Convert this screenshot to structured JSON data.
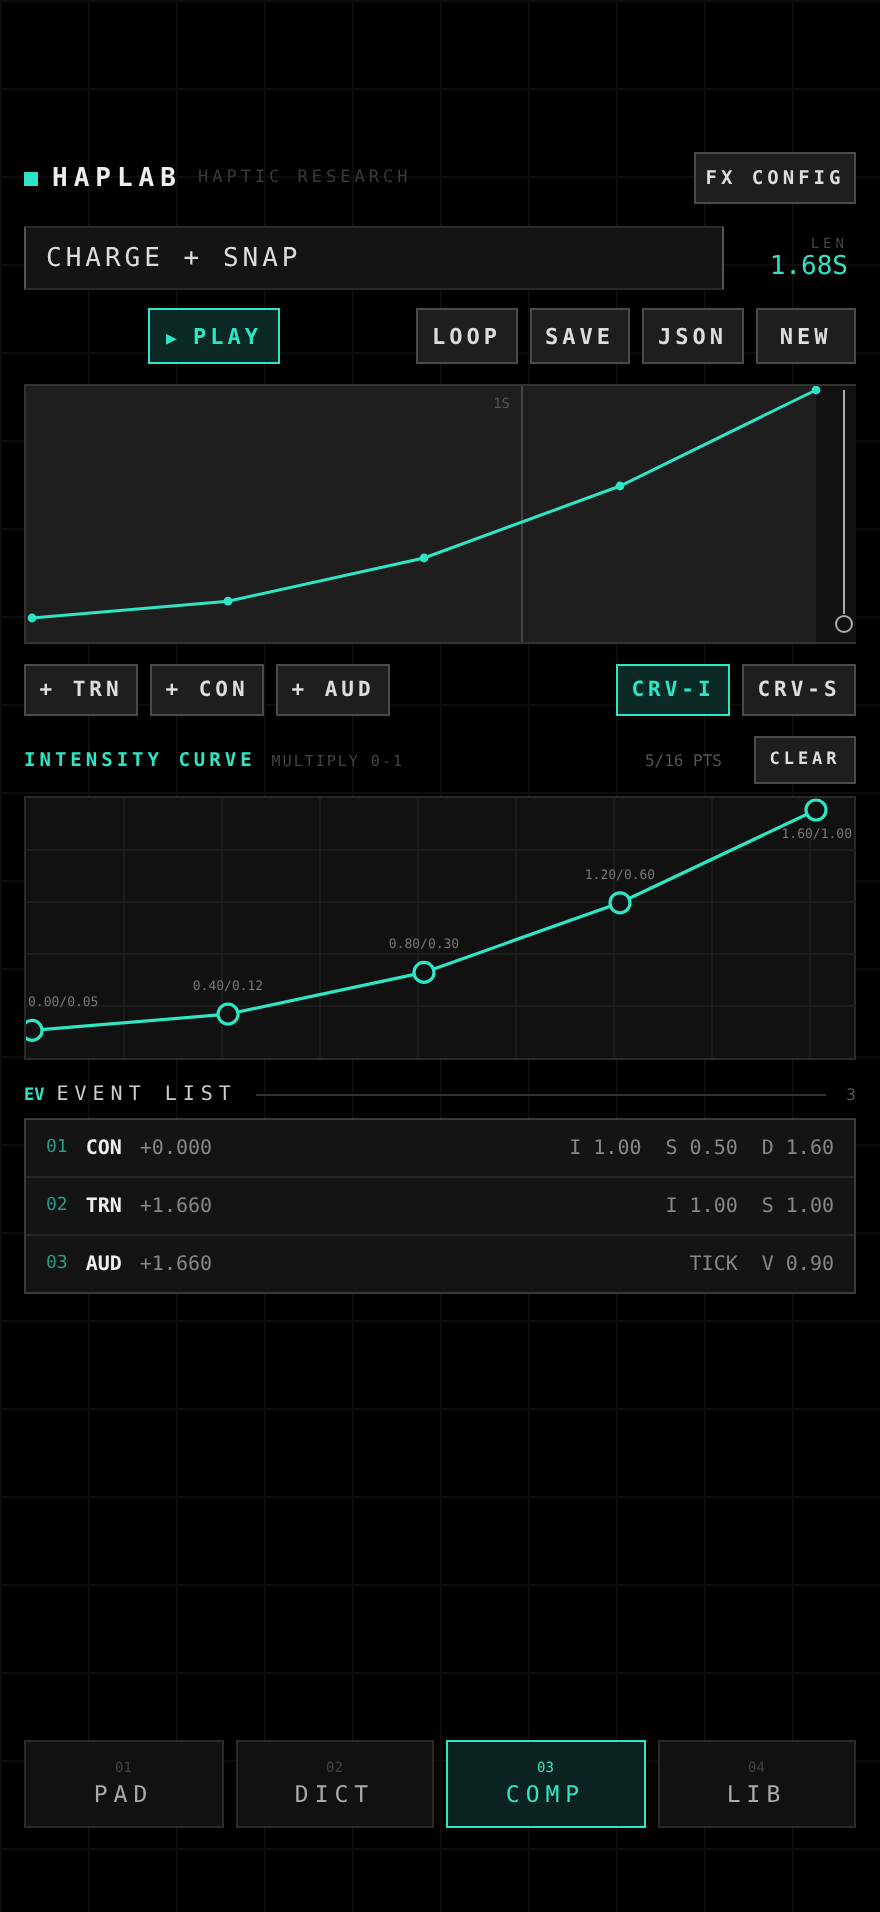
{
  "header": {
    "logo": "HAPLAB",
    "subtitle": "HAPTIC RESEARCH",
    "config_button": "FX CONFIG"
  },
  "pattern": {
    "name": "CHARGE + SNAP",
    "length_label": "LEN",
    "length": "1.68S"
  },
  "transport": [
    {
      "label": "PLAY",
      "icon": "▶",
      "selected": true
    },
    {
      "label": "LOOP",
      "selected": false
    },
    {
      "label": "SAVE",
      "selected": false
    },
    {
      "label": "JSON",
      "selected": false
    },
    {
      "label": "NEW",
      "selected": false
    }
  ],
  "timeline": {
    "tick_label": "1S"
  },
  "add_buttons": [
    "+ TRN",
    "+ CON",
    "+ AUD"
  ],
  "curve_tabs": [
    {
      "label": "CRV-I",
      "selected": true
    },
    {
      "label": "CRV-S",
      "selected": false
    }
  ],
  "intensity": {
    "title": "INTENSITY CURVE",
    "hint": "MULTIPLY 0-1",
    "count": "5/16 PTS",
    "clear_button": "CLEAR",
    "point_labels": [
      "0.00/0.05",
      "0.40/0.12",
      "0.80/0.30",
      "1.20/0.60",
      "1.60/1.00"
    ]
  },
  "event_list": {
    "tag": "EV",
    "title": "EVENT LIST",
    "count": "3",
    "rows": [
      {
        "index": "01",
        "type": "CON",
        "offset": "+0.000",
        "params": [
          "I 1.00",
          "S 0.50",
          "D 1.60"
        ]
      },
      {
        "index": "02",
        "type": "TRN",
        "offset": "+1.660",
        "params": [
          "I 1.00",
          "S 1.00"
        ]
      },
      {
        "index": "03",
        "type": "AUD",
        "offset": "+1.660",
        "params": [
          "TICK",
          "V 0.90"
        ]
      }
    ]
  },
  "nav": [
    {
      "number": "01",
      "label": "PAD",
      "selected": false
    },
    {
      "number": "02",
      "label": "DICT",
      "selected": false
    },
    {
      "number": "03",
      "label": "COMP",
      "selected": true
    },
    {
      "number": "04",
      "label": "LIB",
      "selected": false
    }
  ]
}
